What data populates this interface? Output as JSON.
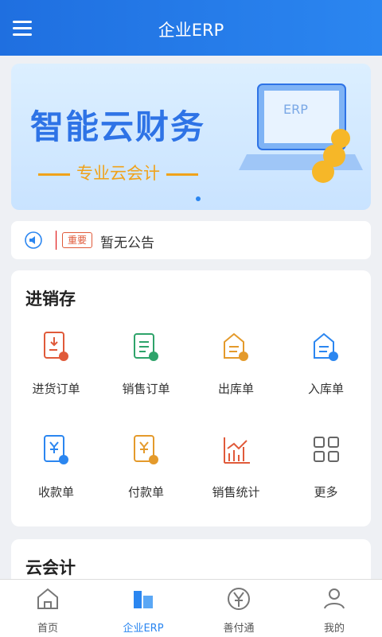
{
  "header": {
    "title": "企业ERP",
    "menu_icon": "menu-icon"
  },
  "banner": {
    "title": "智能云财务",
    "subtitle": "专业云会计",
    "screen_text": "ERP"
  },
  "notice": {
    "badge": "重要",
    "text": "暂无公告"
  },
  "sections": [
    {
      "title": "进销存",
      "items": [
        "进货订单",
        "销售订单",
        "出库单",
        "入库单",
        "收款单",
        "付款单",
        "销售统计",
        "更多"
      ]
    },
    {
      "title": "云会计"
    }
  ],
  "tabbar": {
    "items": [
      "首页",
      "企业ERP",
      "善付通",
      "我的"
    ],
    "active_index": 1
  },
  "colors": {
    "accent": "#2b86f0",
    "red": "#e05a3a",
    "orange": "#f0a21a",
    "green": "#2ea36a",
    "blue": "#2e73e6"
  }
}
